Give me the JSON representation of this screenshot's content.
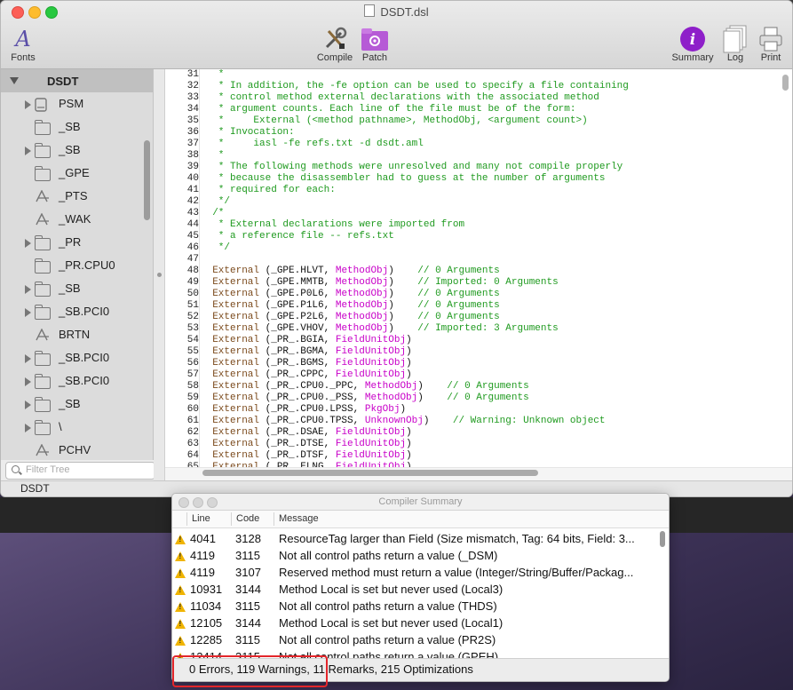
{
  "window": {
    "title": "DSDT.dsl"
  },
  "toolbar": {
    "fonts": "Fonts",
    "compile": "Compile",
    "patch": "Patch",
    "summary": "Summary",
    "log": "Log",
    "print": "Print"
  },
  "sidebar": {
    "root": "DSDT",
    "items": [
      {
        "label": "PSM",
        "icon": "drive-icon",
        "expandable": true
      },
      {
        "label": "_SB",
        "icon": "folder-icon",
        "expandable": false
      },
      {
        "label": "_SB",
        "icon": "folder-icon",
        "expandable": true
      },
      {
        "label": "_GPE",
        "icon": "folder-icon",
        "expandable": false
      },
      {
        "label": "_PTS",
        "icon": "method-icon",
        "expandable": false
      },
      {
        "label": "_WAK",
        "icon": "method-icon",
        "expandable": false
      },
      {
        "label": "_PR",
        "icon": "folder-icon",
        "expandable": true
      },
      {
        "label": "_PR.CPU0",
        "icon": "folder-icon",
        "expandable": false
      },
      {
        "label": "_SB",
        "icon": "folder-icon",
        "expandable": true
      },
      {
        "label": "_SB.PCI0",
        "icon": "folder-icon",
        "expandable": true
      },
      {
        "label": "BRTN",
        "icon": "method-icon",
        "expandable": false
      },
      {
        "label": "_SB.PCI0",
        "icon": "folder-icon",
        "expandable": true
      },
      {
        "label": "_SB.PCI0",
        "icon": "folder-icon",
        "expandable": true
      },
      {
        "label": "_SB",
        "icon": "folder-icon",
        "expandable": true
      },
      {
        "label": "\\",
        "icon": "folder-icon",
        "expandable": true
      },
      {
        "label": "PCHV",
        "icon": "method-icon",
        "expandable": false
      }
    ],
    "filter_placeholder": "Filter Tree"
  },
  "status": {
    "text": "DSDT"
  },
  "editor": {
    "lines": [
      {
        "n": "31",
        "segs": [
          {
            "t": "   *",
            "c": "cm"
          }
        ]
      },
      {
        "n": "32",
        "segs": [
          {
            "t": "   * In addition, the -fe option can be used to specify a file containing",
            "c": "cm"
          }
        ]
      },
      {
        "n": "33",
        "segs": [
          {
            "t": "   * control method external declarations with the associated method",
            "c": "cm"
          }
        ]
      },
      {
        "n": "34",
        "segs": [
          {
            "t": "   * argument counts. Each line of the file must be of the form:",
            "c": "cm"
          }
        ]
      },
      {
        "n": "35",
        "segs": [
          {
            "t": "   *     External (<method pathname>, MethodObj, <argument count>)",
            "c": "cm"
          }
        ]
      },
      {
        "n": "36",
        "segs": [
          {
            "t": "   * Invocation:",
            "c": "cm"
          }
        ]
      },
      {
        "n": "37",
        "segs": [
          {
            "t": "   *     iasl -fe refs.txt -d dsdt.aml",
            "c": "cm"
          }
        ]
      },
      {
        "n": "38",
        "segs": [
          {
            "t": "   *",
            "c": "cm"
          }
        ]
      },
      {
        "n": "39",
        "segs": [
          {
            "t": "   * The following methods were unresolved and many not compile properly",
            "c": "cm"
          }
        ]
      },
      {
        "n": "40",
        "segs": [
          {
            "t": "   * because the disassembler had to guess at the number of arguments",
            "c": "cm"
          }
        ]
      },
      {
        "n": "41",
        "segs": [
          {
            "t": "   * required for each:",
            "c": "cm"
          }
        ]
      },
      {
        "n": "42",
        "segs": [
          {
            "t": "   */",
            "c": "cm"
          }
        ]
      },
      {
        "n": "43",
        "segs": [
          {
            "t": "  /*",
            "c": "cm"
          }
        ]
      },
      {
        "n": "44",
        "segs": [
          {
            "t": "   * External declarations were imported from",
            "c": "cm"
          }
        ]
      },
      {
        "n": "45",
        "segs": [
          {
            "t": "   * a reference file -- refs.txt",
            "c": "cm"
          }
        ]
      },
      {
        "n": "46",
        "segs": [
          {
            "t": "   */",
            "c": "cm"
          }
        ]
      },
      {
        "n": "47",
        "segs": [
          {
            "t": "",
            "c": ""
          }
        ]
      },
      {
        "n": "48",
        "segs": [
          {
            "t": "  External",
            "c": "kw"
          },
          {
            "t": " (_GPE.HLVT, ",
            "c": ""
          },
          {
            "t": "MethodObj",
            "c": "ty"
          },
          {
            "t": ")    ",
            "c": ""
          },
          {
            "t": "// 0 Arguments",
            "c": "cm"
          }
        ]
      },
      {
        "n": "49",
        "segs": [
          {
            "t": "  External",
            "c": "kw"
          },
          {
            "t": " (_GPE.MMTB, ",
            "c": ""
          },
          {
            "t": "MethodObj",
            "c": "ty"
          },
          {
            "t": ")    ",
            "c": ""
          },
          {
            "t": "// Imported: 0 Arguments",
            "c": "cm"
          }
        ]
      },
      {
        "n": "50",
        "segs": [
          {
            "t": "  External",
            "c": "kw"
          },
          {
            "t": " (_GPE.P0L6, ",
            "c": ""
          },
          {
            "t": "MethodObj",
            "c": "ty"
          },
          {
            "t": ")    ",
            "c": ""
          },
          {
            "t": "// 0 Arguments",
            "c": "cm"
          }
        ]
      },
      {
        "n": "51",
        "segs": [
          {
            "t": "  External",
            "c": "kw"
          },
          {
            "t": " (_GPE.P1L6, ",
            "c": ""
          },
          {
            "t": "MethodObj",
            "c": "ty"
          },
          {
            "t": ")    ",
            "c": ""
          },
          {
            "t": "// 0 Arguments",
            "c": "cm"
          }
        ]
      },
      {
        "n": "52",
        "segs": [
          {
            "t": "  External",
            "c": "kw"
          },
          {
            "t": " (_GPE.P2L6, ",
            "c": ""
          },
          {
            "t": "MethodObj",
            "c": "ty"
          },
          {
            "t": ")    ",
            "c": ""
          },
          {
            "t": "// 0 Arguments",
            "c": "cm"
          }
        ]
      },
      {
        "n": "53",
        "segs": [
          {
            "t": "  External",
            "c": "kw"
          },
          {
            "t": " (_GPE.VHOV, ",
            "c": ""
          },
          {
            "t": "MethodObj",
            "c": "ty"
          },
          {
            "t": ")    ",
            "c": ""
          },
          {
            "t": "// Imported: 3 Arguments",
            "c": "cm"
          }
        ]
      },
      {
        "n": "54",
        "segs": [
          {
            "t": "  External",
            "c": "kw"
          },
          {
            "t": " (_PR_.BGIA, ",
            "c": ""
          },
          {
            "t": "FieldUnitObj",
            "c": "ty"
          },
          {
            "t": ")",
            "c": ""
          }
        ]
      },
      {
        "n": "55",
        "segs": [
          {
            "t": "  External",
            "c": "kw"
          },
          {
            "t": " (_PR_.BGMA, ",
            "c": ""
          },
          {
            "t": "FieldUnitObj",
            "c": "ty"
          },
          {
            "t": ")",
            "c": ""
          }
        ]
      },
      {
        "n": "56",
        "segs": [
          {
            "t": "  External",
            "c": "kw"
          },
          {
            "t": " (_PR_.BGMS, ",
            "c": ""
          },
          {
            "t": "FieldUnitObj",
            "c": "ty"
          },
          {
            "t": ")",
            "c": ""
          }
        ]
      },
      {
        "n": "57",
        "segs": [
          {
            "t": "  External",
            "c": "kw"
          },
          {
            "t": " (_PR_.CPPC, ",
            "c": ""
          },
          {
            "t": "FieldUnitObj",
            "c": "ty"
          },
          {
            "t": ")",
            "c": ""
          }
        ]
      },
      {
        "n": "58",
        "segs": [
          {
            "t": "  External",
            "c": "kw"
          },
          {
            "t": " (_PR_.CPU0._PPC, ",
            "c": ""
          },
          {
            "t": "MethodObj",
            "c": "ty"
          },
          {
            "t": ")    ",
            "c": ""
          },
          {
            "t": "// 0 Arguments",
            "c": "cm"
          }
        ]
      },
      {
        "n": "59",
        "segs": [
          {
            "t": "  External",
            "c": "kw"
          },
          {
            "t": " (_PR_.CPU0._PSS, ",
            "c": ""
          },
          {
            "t": "MethodObj",
            "c": "ty"
          },
          {
            "t": ")    ",
            "c": ""
          },
          {
            "t": "// 0 Arguments",
            "c": "cm"
          }
        ]
      },
      {
        "n": "60",
        "segs": [
          {
            "t": "  External",
            "c": "kw"
          },
          {
            "t": " (_PR_.CPU0.LPSS, ",
            "c": ""
          },
          {
            "t": "PkgObj",
            "c": "ty"
          },
          {
            "t": ")",
            "c": ""
          }
        ]
      },
      {
        "n": "61",
        "segs": [
          {
            "t": "  External",
            "c": "kw"
          },
          {
            "t": " (_PR_.CPU0.TPSS, ",
            "c": ""
          },
          {
            "t": "UnknownObj",
            "c": "ty"
          },
          {
            "t": ")    ",
            "c": ""
          },
          {
            "t": "// Warning: Unknown object",
            "c": "cm"
          }
        ]
      },
      {
        "n": "62",
        "segs": [
          {
            "t": "  External",
            "c": "kw"
          },
          {
            "t": " (_PR_.DSAE, ",
            "c": ""
          },
          {
            "t": "FieldUnitObj",
            "c": "ty"
          },
          {
            "t": ")",
            "c": ""
          }
        ]
      },
      {
        "n": "63",
        "segs": [
          {
            "t": "  External",
            "c": "kw"
          },
          {
            "t": " (_PR_.DTSE, ",
            "c": ""
          },
          {
            "t": "FieldUnitObj",
            "c": "ty"
          },
          {
            "t": ")",
            "c": ""
          }
        ]
      },
      {
        "n": "64",
        "segs": [
          {
            "t": "  External",
            "c": "kw"
          },
          {
            "t": " (_PR_.DTSF, ",
            "c": ""
          },
          {
            "t": "FieldUnitObj",
            "c": "ty"
          },
          {
            "t": ")",
            "c": ""
          }
        ]
      },
      {
        "n": "65",
        "segs": [
          {
            "t": "  External",
            "c": "kw"
          },
          {
            "t": " (_PR_.ELNG, ",
            "c": ""
          },
          {
            "t": "FieldUnitObj",
            "c": "ty"
          },
          {
            "t": ")",
            "c": ""
          }
        ]
      }
    ]
  },
  "compiler_summary": {
    "title": "Compiler Summary",
    "columns": [
      "Line",
      "Code",
      "Message"
    ],
    "rows": [
      {
        "line": "4041",
        "code": "3128",
        "message": "ResourceTag larger than Field (Size mismatch, Tag: 64 bits, Field: 3..."
      },
      {
        "line": "4119",
        "code": "3115",
        "message": "Not all control paths return a value (_DSM)"
      },
      {
        "line": "4119",
        "code": "3107",
        "message": "Reserved method must return a value (Integer/String/Buffer/Packag..."
      },
      {
        "line": "10931",
        "code": "3144",
        "message": "Method Local is set but never used (Local3)"
      },
      {
        "line": "11034",
        "code": "3115",
        "message": "Not all control paths return a value (THDS)"
      },
      {
        "line": "12105",
        "code": "3144",
        "message": "Method Local is set but never used (Local1)"
      },
      {
        "line": "12285",
        "code": "3115",
        "message": "Not all control paths return a value (PR2S)"
      },
      {
        "line": "12414",
        "code": "3115",
        "message": "Not all control paths return a value (GPEH)"
      }
    ],
    "footer": "0 Errors, 119 Warnings, 11 Remarks, 215 Optimizations"
  },
  "colors": {
    "comment": "#1f9a1f",
    "keyword": "#7b4a1c",
    "type": "#c800c8",
    "warning": "#f0b400",
    "highlight_box": "#e3262b"
  }
}
